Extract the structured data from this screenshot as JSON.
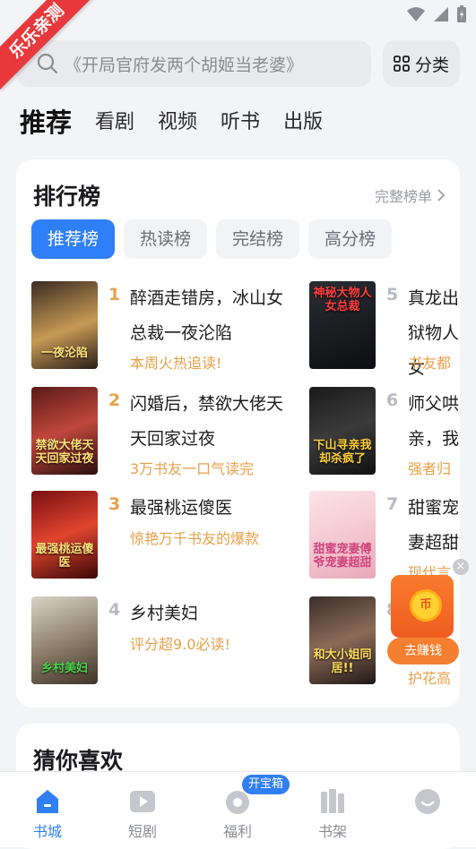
{
  "ribbon": {
    "label": "乐乐亲测"
  },
  "search": {
    "placeholder": "《开局官府发两个胡姬当老婆》"
  },
  "category": {
    "label": "分类"
  },
  "nav_tabs": [
    "推荐",
    "看剧",
    "视频",
    "听书",
    "出版"
  ],
  "ranking": {
    "title": "排行榜",
    "more": "完整榜单",
    "tabs": [
      "推荐榜",
      "热读榜",
      "完结榜",
      "高分榜"
    ],
    "books": [
      {
        "rank": "1",
        "title": "醉酒走错房，冰山女总裁一夜沦陷",
        "tag": "本周火热追读!",
        "cover_text": "一夜沦陷"
      },
      {
        "rank": "2",
        "title": "闪婚后，禁欲大佬天天回家过夜",
        "tag": "3万书友一口气读完",
        "cover_text": "禁欲大佬天天回家过夜"
      },
      {
        "rank": "3",
        "title": "最强桃运傻医",
        "tag": "惊艳万千书友的爆款",
        "cover_text": "最强桃运傻医"
      },
      {
        "rank": "4",
        "title": "乡村美妇",
        "tag": "评分超9.0必读!",
        "cover_text": "乡村美妇"
      },
      {
        "rank": "5",
        "title": "真龙出狱物人女",
        "tag": "书友都",
        "cover_text": "神秘大物人女总裁"
      },
      {
        "rank": "6",
        "title": "师父哄亲，我",
        "tag": "强者归",
        "cover_text": "下山寻亲我却杀疯了"
      },
      {
        "rank": "7",
        "title": "甜蜜宠妻超甜",
        "tag": "现代言",
        "cover_text": "甜蜜宠妻傅爷宠妻超甜"
      },
      {
        "rank": "8",
        "title": "",
        "tag": "护花高",
        "cover_text": "和大小姐同居!!"
      }
    ]
  },
  "guess": {
    "title": "猜你喜欢"
  },
  "floating": {
    "coin_glyph": "币",
    "label": "去赚钱",
    "close": "×"
  },
  "bottom_nav": {
    "items": [
      "书城",
      "短剧",
      "福利",
      "书架",
      ""
    ],
    "badge": "开宝箱"
  }
}
